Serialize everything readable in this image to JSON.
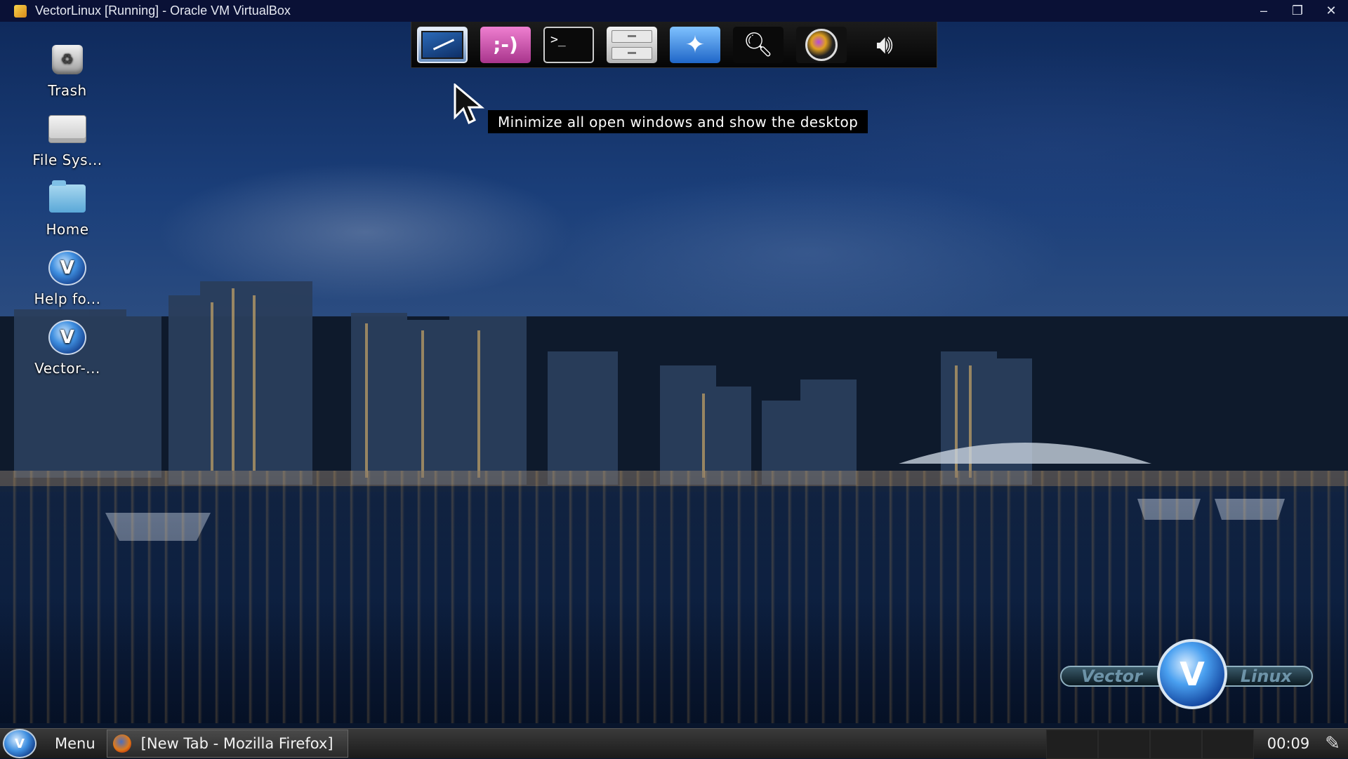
{
  "window": {
    "title": "VectorLinux [Running] - Oracle VM VirtualBox",
    "minimize": "–",
    "restore": "❐",
    "close": "✕"
  },
  "desktop_icons": [
    {
      "label": "Trash",
      "icon": "trash-icon"
    },
    {
      "label": "File Sys...",
      "icon": "drive-icon"
    },
    {
      "label": "Home",
      "icon": "home-folder-icon"
    },
    {
      "label": "Help fo...",
      "icon": "vectorlinux-icon"
    },
    {
      "label": "Vector-...",
      "icon": "vectorlinux-icon"
    }
  ],
  "dock": {
    "items": [
      {
        "name": "show-desktop",
        "icon": "show-desktop-icon"
      },
      {
        "name": "chat",
        "icon": "chat-smiley-icon",
        "glyph": ";-)"
      },
      {
        "name": "terminal",
        "icon": "terminal-icon",
        "glyph": ">_"
      },
      {
        "name": "file-manager",
        "icon": "file-cabinet-icon"
      },
      {
        "name": "web-browser",
        "icon": "compass-icon",
        "glyph": "✦"
      },
      {
        "name": "search",
        "icon": "magnifier-icon",
        "glyph": "🔍︎"
      },
      {
        "name": "camera",
        "icon": "camera-lens-icon"
      },
      {
        "name": "volume",
        "icon": "speaker-icon",
        "glyph": "🔊︎"
      }
    ]
  },
  "tooltip": {
    "text": "Minimize all open windows and show the desktop"
  },
  "logo": {
    "left": "Vector",
    "right": "Linux",
    "mark": "V"
  },
  "panel": {
    "menu_label": "Menu",
    "menu_mark": "V",
    "task": "[New Tab - Mozilla Firefox]",
    "clock": "00:09",
    "tray_glyph": "✎"
  },
  "colors": {
    "titlebar": "#0a1136",
    "panel": "#2a2a2a",
    "tooltip_bg": "#000000"
  }
}
